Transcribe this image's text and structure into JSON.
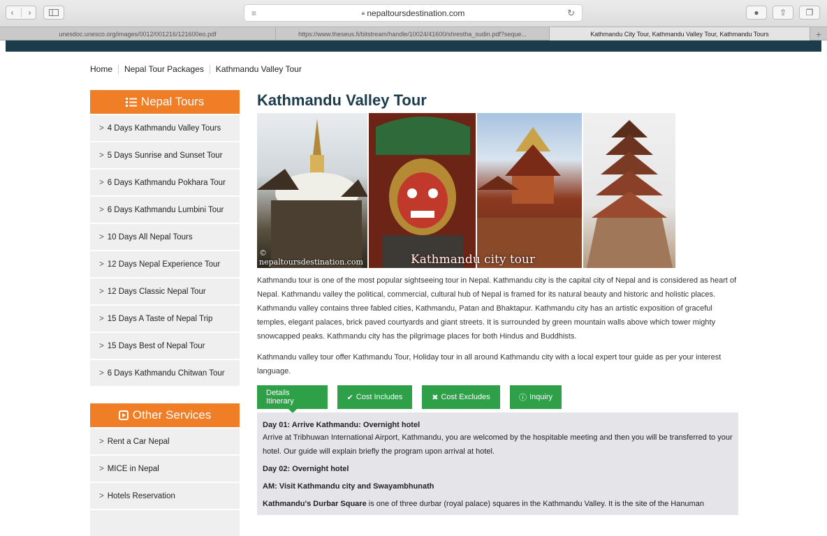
{
  "browser": {
    "url": "nepaltoursdestination.com",
    "tabs": [
      "unesdoc.unesco.org/images/0012/001216/121600eo.pdf",
      "https://www.theseus.fi/bitstream/handle/10024/41600/shrestha_sudin.pdf?seque...",
      "Kathmandu City Tour, Kathmandu Valley Tour, Kathmandu Tours"
    ],
    "new_tab": "+"
  },
  "breadcrumb": [
    "Home",
    "Nepal Tour Packages",
    "Kathmandu Valley Tour"
  ],
  "sidebar": {
    "tours_title": "Nepal Tours",
    "tours": [
      "4 Days Kathmandu Valley Tours",
      "5 Days Sunrise and Sunset Tour",
      "6 Days Kathmandu Pokhara Tour",
      "6 Days Kathmandu Lumbini Tour",
      "10 Days All Nepal Tours",
      "12 Days Nepal Experience Tour",
      "12 Days Classic Nepal Tour",
      "15 Days A Taste of Nepal Trip",
      "15 Days Best of Nepal Tour",
      "6 Days Kathmandu Chitwan Tour"
    ],
    "services_title": "Other Services",
    "services": [
      "Rent a Car Nepal",
      "MICE in Nepal",
      "Hotels Reservation"
    ]
  },
  "main": {
    "title": "Kathmandu Valley Tour",
    "image_credit": "© nepaltoursdestination.com",
    "image_caption": "Kathmandu city tour",
    "para1": "Kathmandu tour is one of the most popular sightseeing tour in Nepal. Kathmandu city is the capital city of Nepal and is considered as heart of Nepal. Kathmandu valley the political, commercial, cultural hub of Nepal is framed for its natural beauty and historic and holistic places. Kathmandu valley contains three fabled cities, Kathmandu, Patan and Bhaktapur. Kathmandu city has an artistic exposition of graceful temples, elegant palaces, brick paved courtyards and giant streets. It is surrounded by green mountain walls above which tower mighty snowcapped peaks. Kathmandu city has the pilgrimage places for both Hindus and Buddhists.",
    "para2": "Kathmandu valley tour offer Kathmandu Tour, Holiday tour in all around Kathmandu city with a local expert tour guide as per your interest language.",
    "tabs": [
      "Details Itinerary",
      "Cost Includes",
      "Cost Excludes",
      "Inquiry"
    ],
    "itinerary": {
      "day1_title": "Day 01: Arrive Kathmandu: Overnight hotel",
      "day1_text": "Arrive at Tribhuwan International Airport, Kathmandu, you are welcomed by the hospitable meeting and then you will be transferred to your hotel. Our guide will explain briefly the program upon arrival at hotel.",
      "day2_title": "Day 02: Overnight hotel",
      "am_title": "AM: Visit Kathmandu city and Swayambhunath",
      "durbar_bold": "Kathmandu's Durbar Square",
      "durbar_text": " is one of three durbar (royal palace) squares in the Kathmandu Valley. It is the site of the Hanuman"
    }
  },
  "colors": {
    "accent_orange": "#f07e26",
    "green": "#2da048",
    "navy": "#1c3c4c"
  }
}
